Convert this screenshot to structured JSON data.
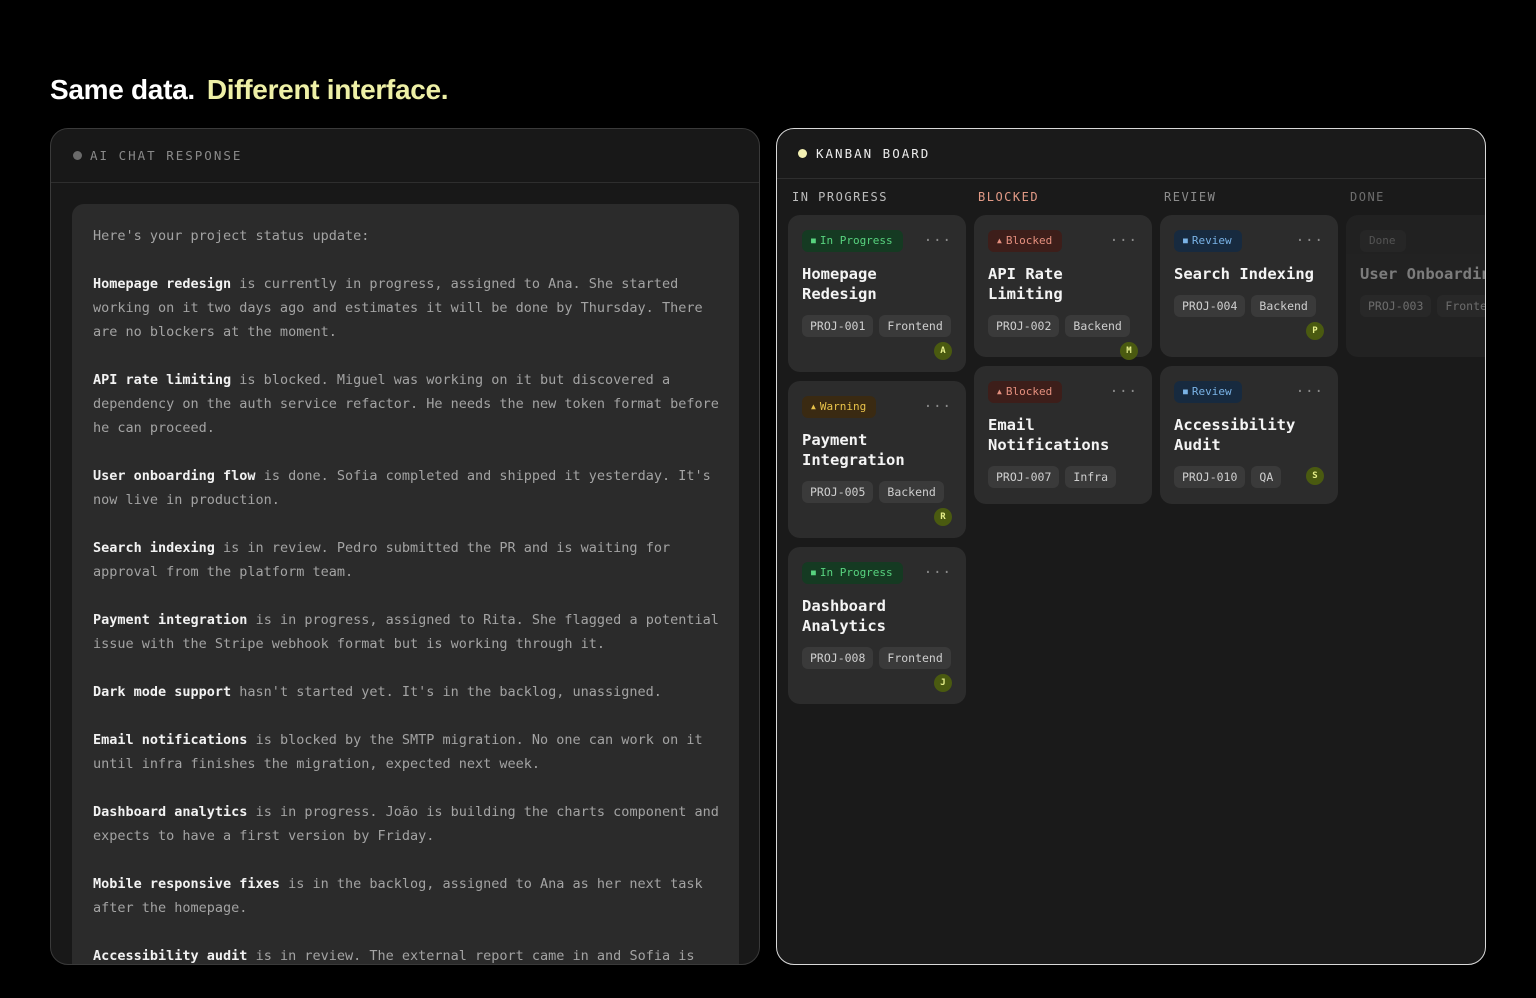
{
  "headline": {
    "part1": "Same data.",
    "part2": "Different interface."
  },
  "chat": {
    "title": "AI CHAT RESPONSE",
    "intro": "Here's your project status update:",
    "paragraphs": [
      {
        "bold": "Homepage redesign",
        "text": " is currently in progress, assigned to Ana. She started working on it two days ago and estimates it will be done by Thursday. There are no blockers at the moment."
      },
      {
        "bold": "API rate limiting",
        "text": " is blocked. Miguel was working on it but discovered a dependency on the auth service refactor. He needs the new token format before he can proceed."
      },
      {
        "bold": "User onboarding flow",
        "text": " is done. Sofia completed and shipped it yesterday. It's now live in production."
      },
      {
        "bold": "Search indexing",
        "text": " is in review. Pedro submitted the PR and is waiting for approval from the platform team."
      },
      {
        "bold": "Payment integration",
        "text": " is in progress, assigned to Rita. She flagged a potential issue with the Stripe webhook format but is working through it."
      },
      {
        "bold": "Dark mode support",
        "text": " hasn't started yet. It's in the backlog, unassigned."
      },
      {
        "bold": "Email notifications",
        "text": " is blocked by the SMTP migration. No one can work on it until infra finishes the migration, expected next week."
      },
      {
        "bold": "Dashboard analytics",
        "text": " is in progress. João is building the charts component and expects to have a first version by Friday."
      },
      {
        "bold": "Mobile responsive fixes",
        "text": " is in the backlog, assigned to Ana as her next task after the homepage."
      },
      {
        "bold": "Accessibility audit",
        "text": " is in review. The external report came in and Sofia is triaging the findings."
      }
    ]
  },
  "kanban": {
    "title": "KANBAN BOARD",
    "columns": [
      {
        "title": "IN PROGRESS",
        "cards": [
          {
            "badge": "In Progress",
            "title_lines": [
              "Homepage",
              "Redesign"
            ],
            "tags": [
              "PROJ-001",
              "Frontend"
            ],
            "avatar": "A"
          },
          {
            "badge": "Warning",
            "title_lines": [
              "Payment",
              "Integration"
            ],
            "tags": [
              "PROJ-005",
              "Backend"
            ],
            "avatar": "R"
          },
          {
            "badge": "In Progress",
            "title_lines": [
              "Dashboard",
              "Analytics"
            ],
            "tags": [
              "PROJ-008",
              "Frontend"
            ],
            "avatar": "J"
          }
        ]
      },
      {
        "title": "BLOCKED",
        "cards": [
          {
            "badge": "Blocked",
            "title_lines": [
              "API Rate Limiting"
            ],
            "tags": [
              "PROJ-002",
              "Backend"
            ],
            "avatar": "M"
          },
          {
            "badge": "Blocked",
            "title_lines": [
              "Email",
              "Notifications"
            ],
            "tags": [
              "PROJ-007",
              "Infra"
            ],
            "avatar": ""
          }
        ]
      },
      {
        "title": "REVIEW",
        "cards": [
          {
            "badge": "Review",
            "title_lines": [
              "Search Indexing"
            ],
            "tags": [
              "PROJ-004",
              "Backend"
            ],
            "avatar": "P"
          },
          {
            "badge": "Review",
            "title_lines": [
              "Accessibility",
              "Audit"
            ],
            "tags": [
              "PROJ-010",
              "QA"
            ],
            "avatar": "S"
          }
        ]
      },
      {
        "title": "DONE",
        "cards": [
          {
            "badge": "Done",
            "title_lines": [
              "User Onboarding"
            ],
            "tags": [
              "PROJ-003",
              "Frontend"
            ],
            "avatar": ""
          }
        ]
      }
    ]
  },
  "colors": {
    "accent": "#eef0a6",
    "in_progress": "#58d37f",
    "warning": "#e8c24a",
    "blocked": "#e5907f",
    "review": "#7ab3e6"
  }
}
